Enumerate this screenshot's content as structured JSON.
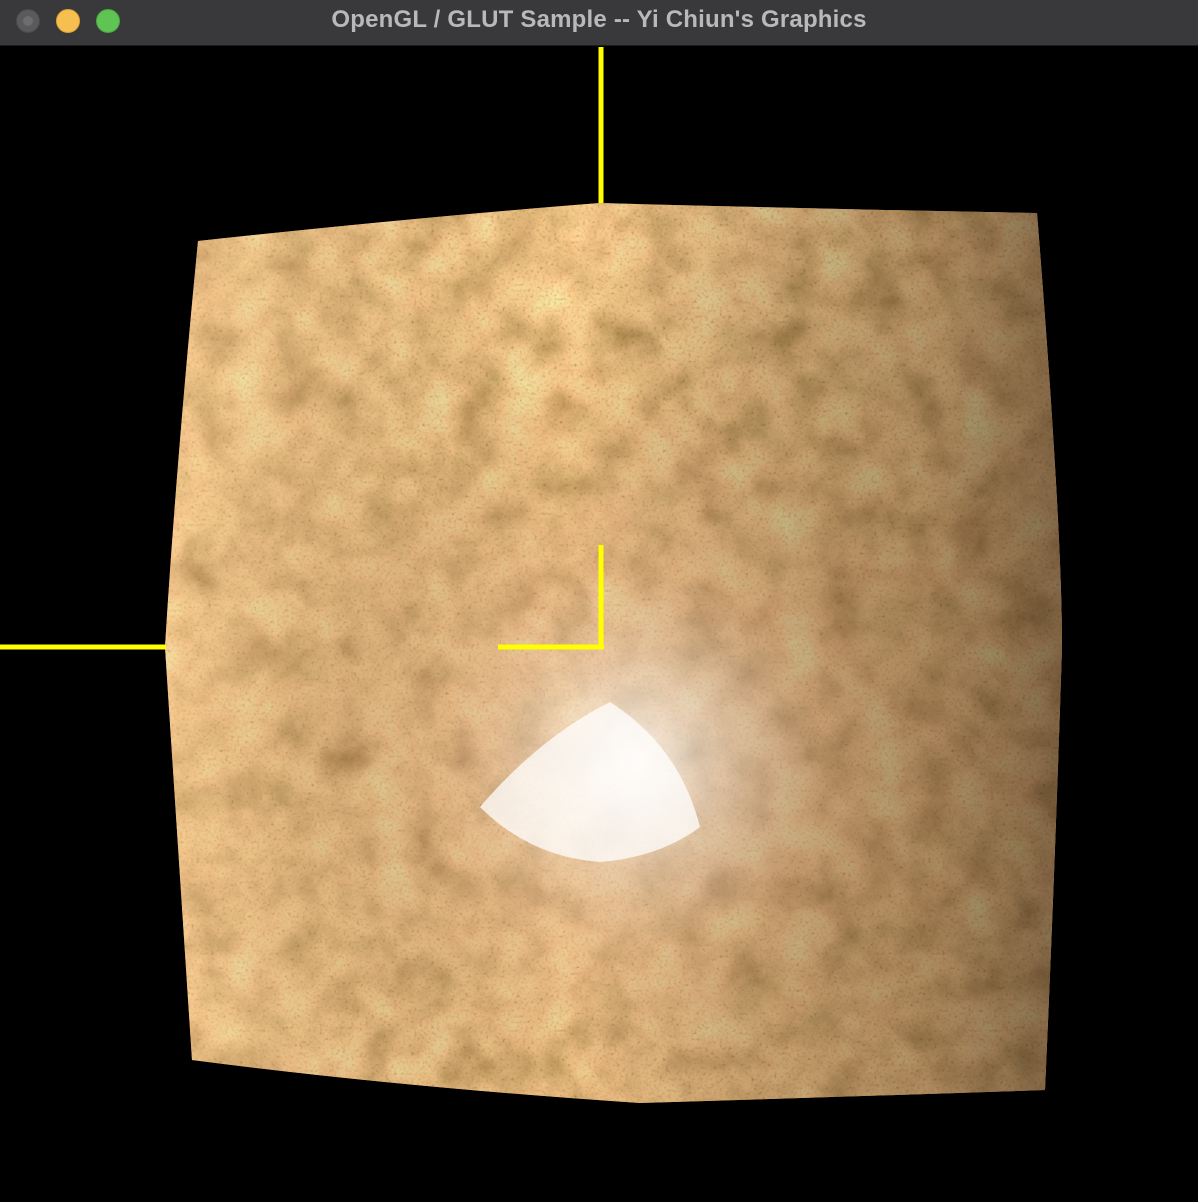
{
  "window": {
    "title": "OpenGL / GLUT Sample -- Yi Chiun's Graphics"
  },
  "colors": {
    "titlebar": "#39393b",
    "title_text": "#b9b9bb",
    "close": "#5a5a5c",
    "minimize": "#f6bf4f",
    "zoom": "#5fc453",
    "background": "#000000",
    "axes": "#ffff00"
  },
  "scene": {
    "object": "bump-mapped textured surface",
    "texture": "rust-stone"
  },
  "icons": {
    "close": "close-button",
    "minimize": "minimize-button",
    "zoom": "zoom-button"
  }
}
